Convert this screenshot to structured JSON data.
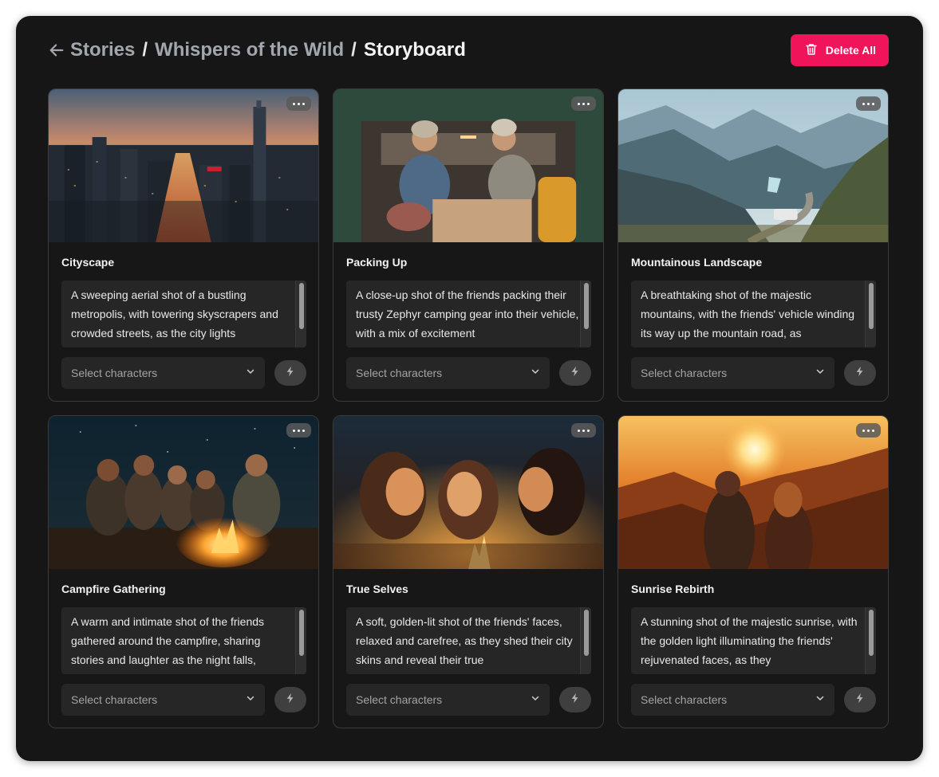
{
  "breadcrumb": {
    "items": [
      "Stories",
      "Whispers of the Wild"
    ],
    "separator": "/",
    "current": "Storyboard"
  },
  "actions": {
    "delete_all_label": "Delete All"
  },
  "colors": {
    "accent": "#f0145a",
    "panel": "#161616",
    "card_border": "#3b3b3b"
  },
  "cards": [
    {
      "title": "Cityscape",
      "description": "A sweeping aerial shot of a bustling metropolis, with towering skyscrapers and crowded streets, as the city lights",
      "select_placeholder": "Select characters",
      "image": "city-aerial-dusk"
    },
    {
      "title": "Packing Up",
      "description": "A close-up shot of the friends packing their trusty Zephyr camping gear into their vehicle, with a mix of excitement",
      "select_placeholder": "Select characters",
      "image": "friends-in-car-trunk"
    },
    {
      "title": "Mountainous Landscape",
      "description": "A breathtaking shot of the majestic mountains, with the friends' vehicle winding its way up the mountain road, as",
      "select_placeholder": "Select characters",
      "image": "mountain-road"
    },
    {
      "title": "Campfire Gathering",
      "description": "A warm and intimate shot of the friends gathered around the campfire, sharing stories and laughter as the night falls,",
      "select_placeholder": "Select characters",
      "image": "campfire-group"
    },
    {
      "title": "True Selves",
      "description": "A soft, golden-lit shot of the friends' faces, relaxed and carefree, as they shed their city skins and reveal their true",
      "select_placeholder": "Select characters",
      "image": "faces-firelight"
    },
    {
      "title": "Sunrise Rebirth",
      "description": "A stunning shot of the majestic sunrise, with the golden light illuminating the friends' rejuvenated faces, as they",
      "select_placeholder": "Select characters",
      "image": "sunrise-silhouettes"
    }
  ]
}
